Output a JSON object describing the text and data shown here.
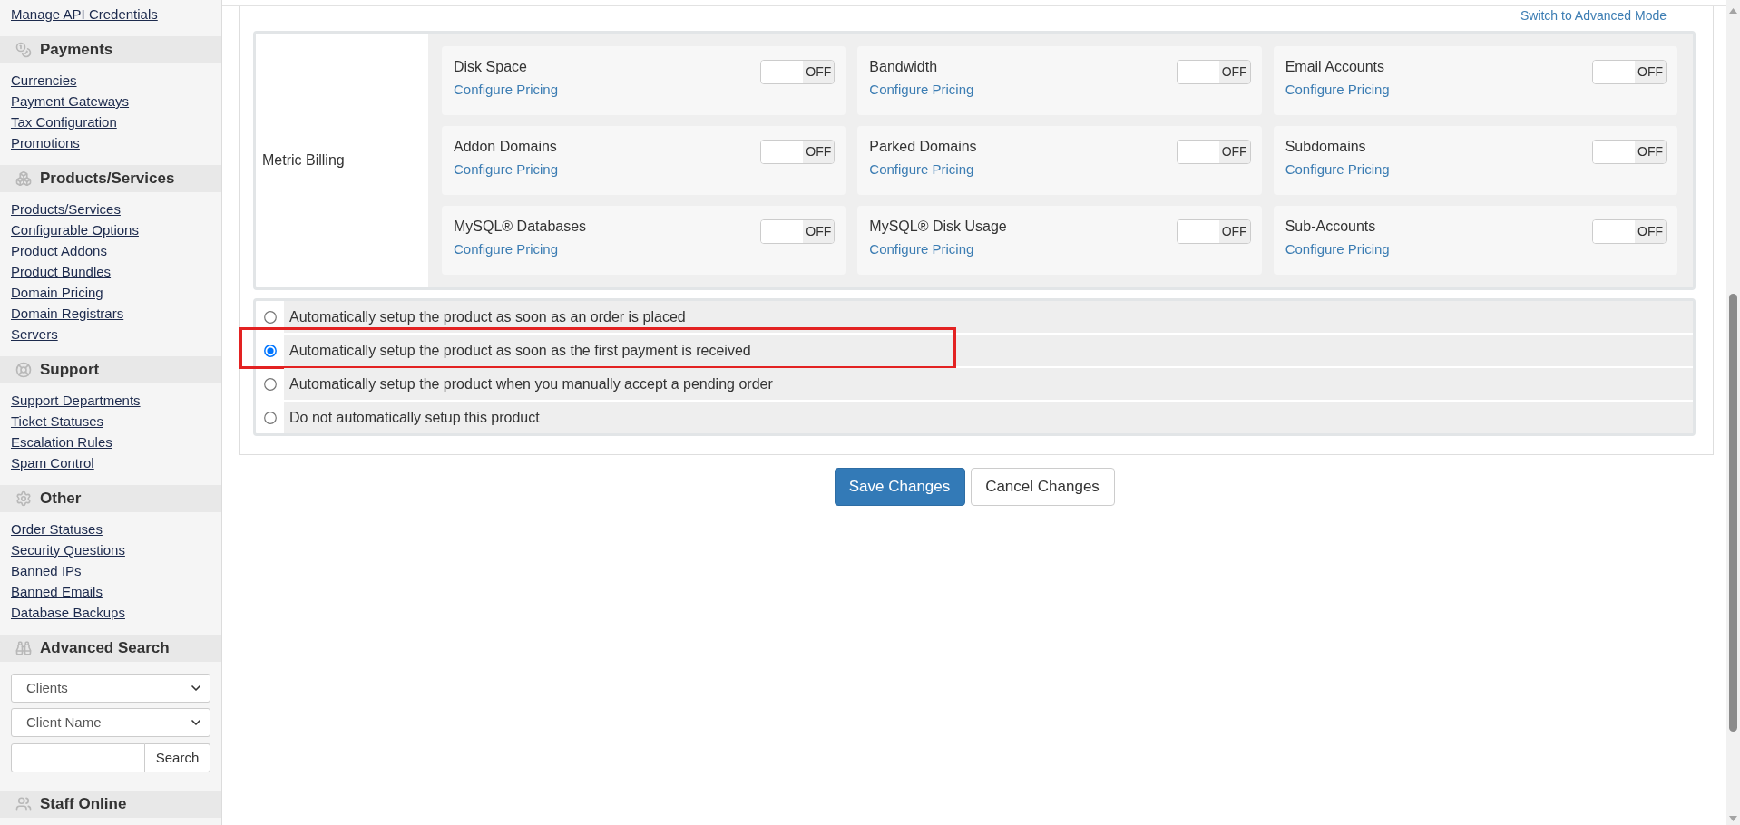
{
  "sidebar": {
    "top_link": "Manage API Credentials",
    "sections": [
      {
        "title": "Payments",
        "links": [
          "Currencies",
          "Payment Gateways",
          "Tax Configuration",
          "Promotions"
        ]
      },
      {
        "title": "Products/Services",
        "links": [
          "Products/Services",
          "Configurable Options",
          "Product Addons",
          "Product Bundles",
          "Domain Pricing",
          "Domain Registrars",
          "Servers"
        ]
      },
      {
        "title": "Support",
        "links": [
          "Support Departments",
          "Ticket Statuses",
          "Escalation Rules",
          "Spam Control"
        ]
      },
      {
        "title": "Other",
        "links": [
          "Order Statuses",
          "Security Questions",
          "Banned IPs",
          "Banned Emails",
          "Database Backups"
        ]
      }
    ],
    "advanced_search": {
      "title": "Advanced Search",
      "selects": [
        {
          "value": "Clients"
        },
        {
          "value": "Client Name"
        }
      ],
      "search_button": "Search"
    },
    "staff_online": {
      "title": "Staff Online"
    }
  },
  "main": {
    "mode_link": "Switch to Advanced Mode",
    "metric_billing": {
      "label": "Metric Billing",
      "metrics": [
        {
          "name": "Disk Space",
          "link": "Configure Pricing",
          "on": false,
          "toggle_label": "OFF"
        },
        {
          "name": "Bandwidth",
          "link": "Configure Pricing",
          "on": false,
          "toggle_label": "OFF"
        },
        {
          "name": "Email Accounts",
          "link": "Configure Pricing",
          "on": false,
          "toggle_label": "OFF"
        },
        {
          "name": "Addon Domains",
          "link": "Configure Pricing",
          "on": false,
          "toggle_label": "OFF"
        },
        {
          "name": "Parked Domains",
          "link": "Configure Pricing",
          "on": false,
          "toggle_label": "OFF"
        },
        {
          "name": "Subdomains",
          "link": "Configure Pricing",
          "on": false,
          "toggle_label": "OFF"
        },
        {
          "name": "MySQL® Databases",
          "link": "Configure Pricing",
          "on": false,
          "toggle_label": "OFF"
        },
        {
          "name": "MySQL® Disk Usage",
          "link": "Configure Pricing",
          "on": false,
          "toggle_label": "OFF"
        },
        {
          "name": "Sub-Accounts",
          "link": "Configure Pricing",
          "on": false,
          "toggle_label": "OFF"
        }
      ]
    },
    "setup_options": [
      {
        "label": "Automatically setup the product as soon as an order is placed",
        "selected": false,
        "highlighted": false
      },
      {
        "label": "Automatically setup the product as soon as the first payment is received",
        "selected": true,
        "highlighted": true
      },
      {
        "label": "Automatically setup the product when you manually accept a pending order",
        "selected": false,
        "highlighted": false
      },
      {
        "label": "Do not automatically setup this product",
        "selected": false,
        "highlighted": false
      }
    ],
    "buttons": [
      {
        "label": "Save Changes",
        "kind": "primary"
      },
      {
        "label": "Cancel Changes",
        "kind": "default"
      }
    ]
  }
}
